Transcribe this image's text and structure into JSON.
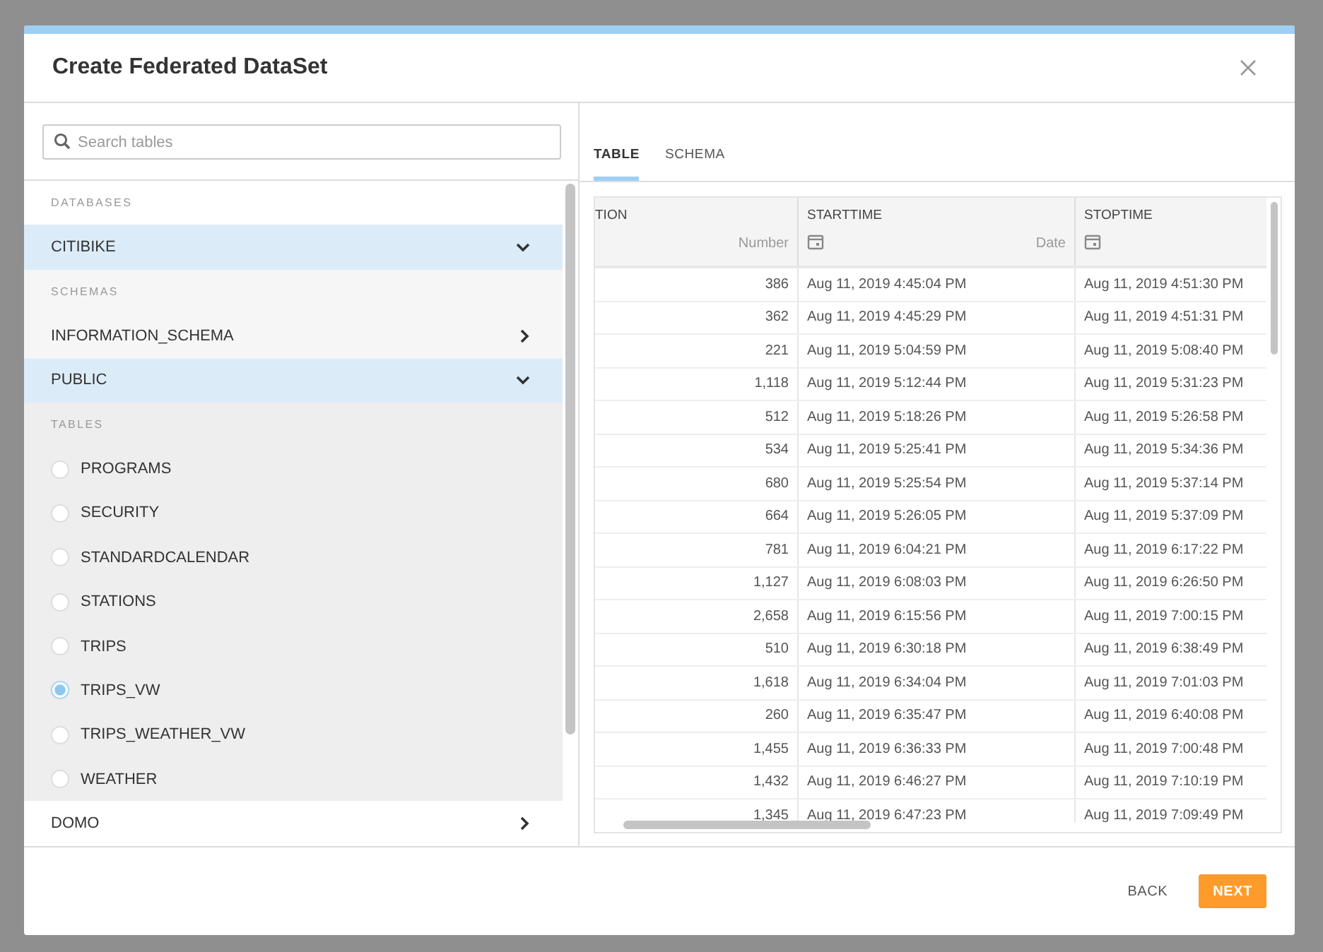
{
  "dialog": {
    "title": "Create Federated DataSet"
  },
  "sidebar": {
    "search": {
      "placeholder": "Search tables"
    },
    "databases_label": "DATABASES",
    "databases": [
      {
        "name": "CITIBIKE",
        "expanded": true,
        "children_label": "SCHEMAS",
        "children": [
          {
            "name": "INFORMATION_SCHEMA",
            "expanded": false
          },
          {
            "name": "PUBLIC",
            "expanded": true,
            "children_label": "TABLES",
            "children": [
              {
                "name": "PROGRAMS",
                "selected": false
              },
              {
                "name": "SECURITY",
                "selected": false
              },
              {
                "name": "STANDARDCALENDAR",
                "selected": false
              },
              {
                "name": "STATIONS",
                "selected": false
              },
              {
                "name": "TRIPS",
                "selected": false
              },
              {
                "name": "TRIPS_VW",
                "selected": true
              },
              {
                "name": "TRIPS_WEATHER_VW",
                "selected": false
              },
              {
                "name": "WEATHER",
                "selected": false
              }
            ]
          }
        ]
      },
      {
        "name": "DOMO",
        "expanded": false
      }
    ]
  },
  "tabs": [
    {
      "label": "TABLE",
      "selected": true
    },
    {
      "label": "SCHEMA",
      "selected": false
    }
  ],
  "table": {
    "columns": [
      {
        "name": "TION",
        "type": "Number",
        "kind": "number"
      },
      {
        "name": "STARTTIME",
        "type": "Date",
        "kind": "date"
      },
      {
        "name": "STOPTIME",
        "kind": "date"
      }
    ],
    "rows": [
      [
        "386",
        "Aug 11, 2019 4:45:04 PM",
        "Aug 11, 2019 4:51:30 PM"
      ],
      [
        "362",
        "Aug 11, 2019 4:45:29 PM",
        "Aug 11, 2019 4:51:31 PM"
      ],
      [
        "221",
        "Aug 11, 2019 5:04:59 PM",
        "Aug 11, 2019 5:08:40 PM"
      ],
      [
        "1,118",
        "Aug 11, 2019 5:12:44 PM",
        "Aug 11, 2019 5:31:23 PM"
      ],
      [
        "512",
        "Aug 11, 2019 5:18:26 PM",
        "Aug 11, 2019 5:26:58 PM"
      ],
      [
        "534",
        "Aug 11, 2019 5:25:41 PM",
        "Aug 11, 2019 5:34:36 PM"
      ],
      [
        "680",
        "Aug 11, 2019 5:25:54 PM",
        "Aug 11, 2019 5:37:14 PM"
      ],
      [
        "664",
        "Aug 11, 2019 5:26:05 PM",
        "Aug 11, 2019 5:37:09 PM"
      ],
      [
        "781",
        "Aug 11, 2019 6:04:21 PM",
        "Aug 11, 2019 6:17:22 PM"
      ],
      [
        "1,127",
        "Aug 11, 2019 6:08:03 PM",
        "Aug 11, 2019 6:26:50 PM"
      ],
      [
        "2,658",
        "Aug 11, 2019 6:15:56 PM",
        "Aug 11, 2019 7:00:15 PM"
      ],
      [
        "510",
        "Aug 11, 2019 6:30:18 PM",
        "Aug 11, 2019 6:38:49 PM"
      ],
      [
        "1,618",
        "Aug 11, 2019 6:34:04 PM",
        "Aug 11, 2019 7:01:03 PM"
      ],
      [
        "260",
        "Aug 11, 2019 6:35:47 PM",
        "Aug 11, 2019 6:40:08 PM"
      ],
      [
        "1,455",
        "Aug 11, 2019 6:36:33 PM",
        "Aug 11, 2019 7:00:48 PM"
      ],
      [
        "1,432",
        "Aug 11, 2019 6:46:27 PM",
        "Aug 11, 2019 7:10:19 PM"
      ],
      [
        "1,345",
        "Aug 11, 2019 6:47:23 PM",
        "Aug 11, 2019 7:09:49 PM"
      ]
    ]
  },
  "footer": {
    "buttons": [
      {
        "label": "BACK",
        "kind": "secondary"
      },
      {
        "label": "NEXT",
        "kind": "primary"
      }
    ]
  }
}
